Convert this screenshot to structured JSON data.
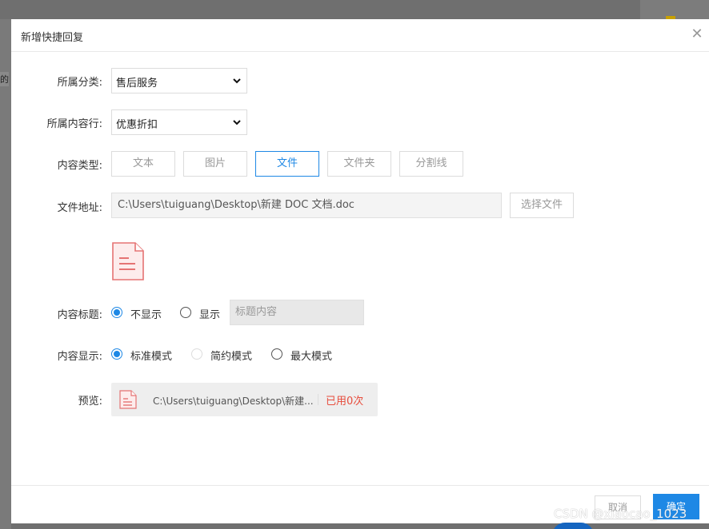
{
  "background": {
    "side_text": "的"
  },
  "dialog": {
    "title": "新增快捷回复",
    "close_glyph": "✕"
  },
  "form": {
    "category": {
      "label": "所属分类:",
      "value": "售后服务"
    },
    "industry": {
      "label": "所属内容行:",
      "value": "优惠折扣"
    },
    "content_type": {
      "label": "内容类型:",
      "options": [
        "文本",
        "图片",
        "文件",
        "文件夹",
        "分割线"
      ],
      "selected": "文件"
    },
    "file_path": {
      "label": "文件地址:",
      "value": "C:\\Users\\tuiguang\\Desktop\\新建 DOC 文档.doc",
      "choose_label": "选择文件"
    },
    "content_title": {
      "label": "内容标题:",
      "options": [
        "不显示",
        "显示"
      ],
      "selected": "不显示",
      "placeholder": "标题内容"
    },
    "content_display": {
      "label": "内容显示:",
      "options": [
        "标准模式",
        "简约模式",
        "最大模式"
      ],
      "selected": "标准模式",
      "disabled": "简约模式"
    },
    "preview": {
      "label": "预览:",
      "path": "C:\\Users\\tuiguang\\Desktop\\新建...",
      "usage": "已用0次"
    }
  },
  "footer": {
    "cancel_label": "取消",
    "ok_label": "确定"
  },
  "watermark": "CSDN @xiaocao_1023",
  "colors": {
    "accent": "#1e88e5",
    "danger": "#e74c3c",
    "file_icon": "#e57373"
  }
}
